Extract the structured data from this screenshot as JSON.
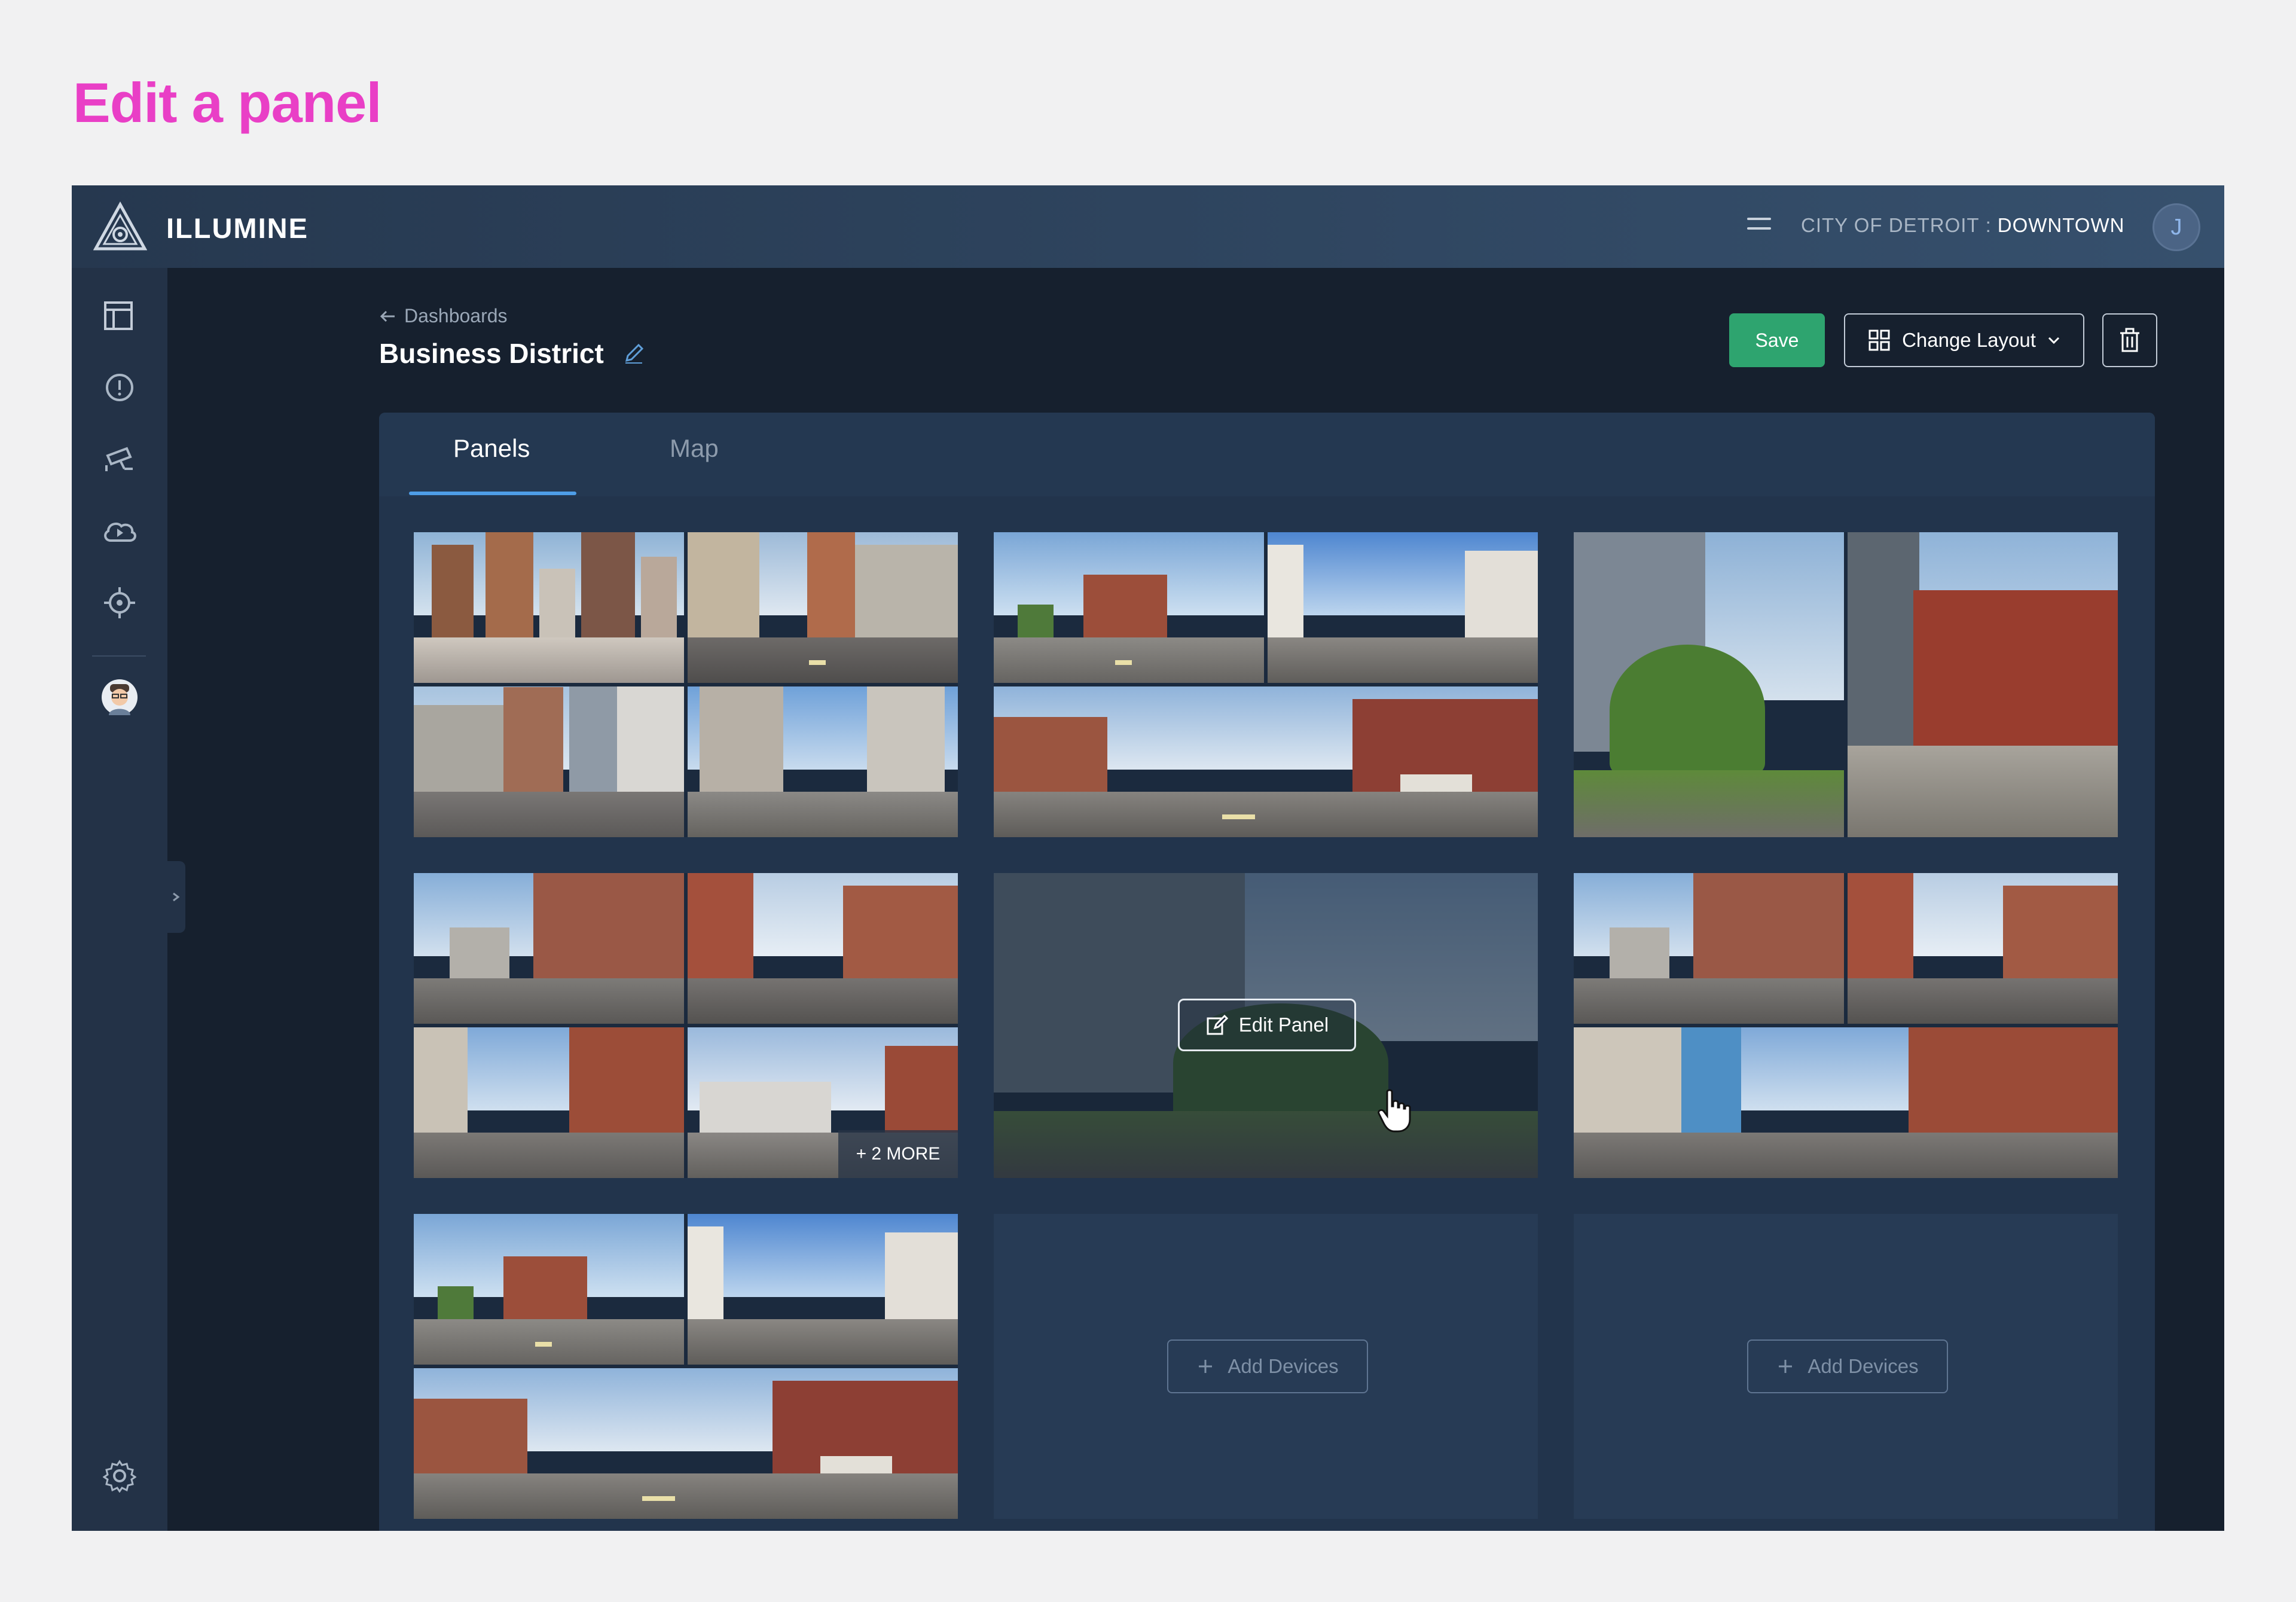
{
  "page_title": "Edit a panel",
  "topbar": {
    "brand": "ILLUMINE",
    "location_city": "CITY OF DETROIT",
    "location_separator": ":",
    "location_area": "DOWNTOWN",
    "user_initial": "J"
  },
  "sidebar": {
    "icons": [
      "layout-icon",
      "alert-icon",
      "camera-icon",
      "cloud-play-icon",
      "target-icon",
      "user-avatar-icon",
      "settings-icon"
    ]
  },
  "header": {
    "breadcrumb": "Dashboards",
    "title": "Business District",
    "save_label": "Save",
    "change_layout_label": "Change Layout"
  },
  "tabs": [
    {
      "label": "Panels",
      "active": true
    },
    {
      "label": "Map",
      "active": false
    }
  ],
  "panels": {
    "more_badge": "+ 2 MORE",
    "edit_panel_label": "Edit Panel",
    "add_devices_label": "Add Devices"
  },
  "colors": {
    "accent_pink": "#e93fc6",
    "save_green": "#2ea46f",
    "tab_underline": "#4e9de7",
    "app_background": "#16202e"
  }
}
